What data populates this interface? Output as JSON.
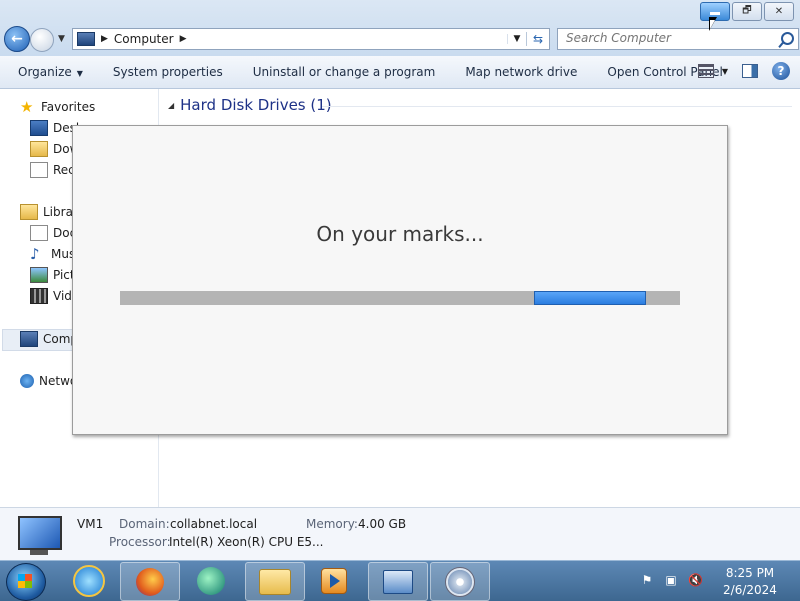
{
  "window": {
    "address": {
      "location": "Computer"
    },
    "search": {
      "placeholder": "Search Computer"
    }
  },
  "toolbar": {
    "organize": "Organize",
    "system_properties": "System properties",
    "uninstall": "Uninstall or change a program",
    "map_drive": "Map network drive",
    "open_control_panel": "Open Control Panel"
  },
  "nav": {
    "favorites": "Favorites",
    "desktop": "Desk",
    "downloads": "Dow",
    "recent": "Rece",
    "libraries": "Librar",
    "documents": "Doc",
    "music": "Mus",
    "pictures": "Pict",
    "videos": "Vide",
    "computer": "Comp",
    "network": "Netwo"
  },
  "content": {
    "group_title": "Hard Disk Drives (1)"
  },
  "dialog": {
    "title": "On your marks...",
    "progress": {
      "start": 0.74,
      "end": 0.94
    }
  },
  "details": {
    "name": "VM1",
    "domain_label": "Domain:",
    "domain_value": "collabnet.local",
    "memory_label": "Memory:",
    "memory_value": "4.00 GB",
    "processor_label": "Processor:",
    "processor_value": "Intel(R) Xeon(R) CPU E5..."
  },
  "taskbar": {
    "clock_time": "8:25 PM",
    "clock_date": "2/6/2024"
  },
  "colors": {
    "progress_fill": "#2b7de0",
    "progress_track": "#b4b4b4",
    "taskbar": "#3d6790",
    "group_title": "#1e3287"
  },
  "icons": [
    "back-icon",
    "forward-icon",
    "computer-icon",
    "refresh-icon",
    "search-icon",
    "views-icon",
    "preview-pane-icon",
    "help-icon",
    "star-icon",
    "start-orb-icon",
    "ie-icon",
    "firefox-icon",
    "explorer-icon",
    "media-player-icon",
    "control-panel-icon",
    "disc-icon",
    "flag-icon",
    "network-tray-icon",
    "volume-muted-icon"
  ]
}
